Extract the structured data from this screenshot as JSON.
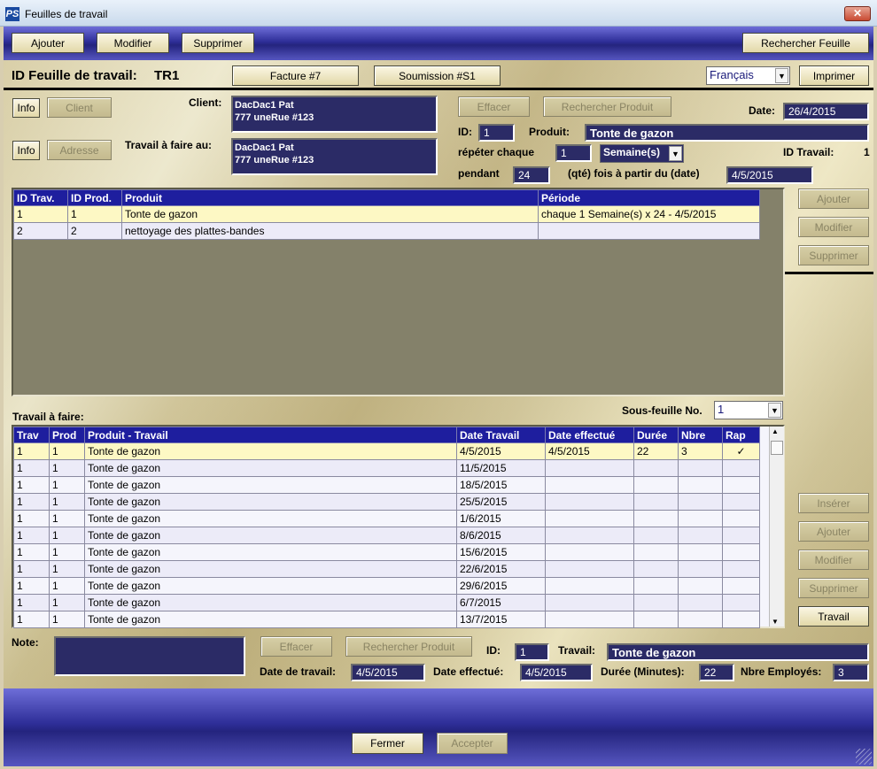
{
  "window": {
    "title": "Feuilles de travail",
    "close": "✕"
  },
  "toolbar": {
    "ajouter": "Ajouter",
    "modifier": "Modifier",
    "supprimer": "Supprimer",
    "rechercher": "Rechercher Feuille"
  },
  "header": {
    "id_label": "ID Feuille de travail:",
    "id_value": "TR1",
    "facture": "Facture #7",
    "soumission": "Soumission #S1",
    "language": "Français",
    "imprimer": "Imprimer"
  },
  "client": {
    "info": "Info",
    "client_btn": "Client",
    "client_label": "Client:",
    "client_lines": [
      "DacDac1 Pat",
      "777 uneRue #123"
    ],
    "info2": "Info",
    "adresse_btn": "Adresse",
    "travail_label": "Travail à faire au:",
    "travail_lines": [
      "DacDac1 Pat",
      "777 uneRue #123"
    ]
  },
  "product": {
    "effacer": "Effacer",
    "rechercher": "Rechercher Produit",
    "date_label": "Date:",
    "date_value": "26/4/2015",
    "id_label": "ID:",
    "id_value": "1",
    "produit_label": "Produit:",
    "produit_value": "Tonte de gazon",
    "repeter_label": "répéter chaque",
    "repeter_value": "1",
    "unit": "Semaine(s)",
    "id_travail_label": "ID Travail:",
    "id_travail_value": "1",
    "pendant_label": "pendant",
    "pendant_value": "24",
    "qte_label": "(qté) fois à partir du (date)",
    "start_date": "4/5/2015"
  },
  "jobs_table": {
    "headers": [
      "ID Trav.",
      "ID Prod.",
      "Produit",
      "Période"
    ],
    "rows": [
      [
        "1",
        "1",
        "Tonte de gazon",
        "chaque 1 Semaine(s) x 24 - 4/5/2015"
      ],
      [
        "2",
        "2",
        "nettoyage des plattes-bandes",
        ""
      ]
    ]
  },
  "side1": {
    "ajouter": "Ajouter",
    "modifier": "Modifier",
    "supprimer": "Supprimer"
  },
  "work": {
    "label": "Travail à faire:",
    "sousfeuille_label": "Sous-feuille No.",
    "sousfeuille_value": "1"
  },
  "work_table": {
    "headers": [
      "Trav",
      "Prod",
      "Produit - Travail",
      "Date Travail",
      "Date effectué",
      "Durée",
      "Nbre",
      "Rap"
    ],
    "rows": [
      [
        "1",
        "1",
        "Tonte de gazon",
        "4/5/2015",
        "4/5/2015",
        "22",
        "3",
        "✓"
      ],
      [
        "1",
        "1",
        "Tonte de gazon",
        "11/5/2015",
        "",
        "",
        "",
        ""
      ],
      [
        "1",
        "1",
        "Tonte de gazon",
        "18/5/2015",
        "",
        "",
        "",
        ""
      ],
      [
        "1",
        "1",
        "Tonte de gazon",
        "25/5/2015",
        "",
        "",
        "",
        ""
      ],
      [
        "1",
        "1",
        "Tonte de gazon",
        "1/6/2015",
        "",
        "",
        "",
        ""
      ],
      [
        "1",
        "1",
        "Tonte de gazon",
        "8/6/2015",
        "",
        "",
        "",
        ""
      ],
      [
        "1",
        "1",
        "Tonte de gazon",
        "15/6/2015",
        "",
        "",
        "",
        ""
      ],
      [
        "1",
        "1",
        "Tonte de gazon",
        "22/6/2015",
        "",
        "",
        "",
        ""
      ],
      [
        "1",
        "1",
        "Tonte de gazon",
        "29/6/2015",
        "",
        "",
        "",
        ""
      ],
      [
        "1",
        "1",
        "Tonte de gazon",
        "6/7/2015",
        "",
        "",
        "",
        ""
      ],
      [
        "1",
        "1",
        "Tonte de gazon",
        "13/7/2015",
        "",
        "",
        "",
        ""
      ]
    ]
  },
  "side2": {
    "inserer": "Insérer",
    "ajouter": "Ajouter",
    "modifier": "Modifier",
    "supprimer": "Supprimer",
    "travail": "Travail"
  },
  "detail": {
    "note_label": "Note:",
    "effacer": "Effacer",
    "rechercher": "Rechercher Produit",
    "id_label": "ID:",
    "id_value": "1",
    "travail_label": "Travail:",
    "travail_value": "Tonte de gazon",
    "date_travail_label": "Date de travail:",
    "date_travail_value": "4/5/2015",
    "date_effectue_label": "Date effectué:",
    "date_effectue_value": "4/5/2015",
    "duree_label": "Durée (Minutes):",
    "duree_value": "22",
    "nbre_label": "Nbre Employés:",
    "nbre_value": "3"
  },
  "footer": {
    "fermer": "Fermer",
    "accepter": "Accepter"
  }
}
